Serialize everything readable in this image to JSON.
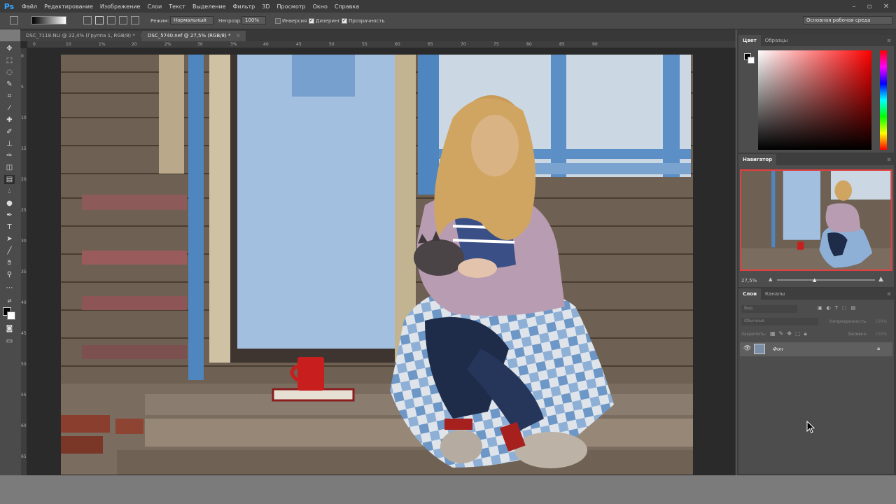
{
  "app": {
    "logo": "Ps",
    "menu": [
      "Файл",
      "Редактирование",
      "Изображение",
      "Слои",
      "Текст",
      "Выделение",
      "Фильтр",
      "3D",
      "Просмотр",
      "Окно",
      "Справка"
    ]
  },
  "options": {
    "mode_label": "Режим:",
    "mode_value": "Нормальный",
    "opacity_label": "Непрозр.:",
    "opacity_value": "100%",
    "inverse_label": "Инверсия",
    "dither_label": "Дизеринг",
    "transparency_label": "Прозрачность",
    "inverse_checked": false,
    "dither_checked": true,
    "transparency_checked": true,
    "workspace": "Основная рабочая среда"
  },
  "tabs": [
    {
      "label": "DSC_7118.NLI @ 22,4% (Группа 1, RGB/8) *",
      "active": false
    },
    {
      "label": "DSC_5740.nef @ 27,5% (RGB/8) *",
      "active": true
    }
  ],
  "ruler": {
    "h_labels": [
      "0",
      "10",
      "1%",
      "20",
      "2%",
      "30",
      "3%",
      "40",
      "45",
      "50",
      "55",
      "60",
      "65",
      "70",
      "75",
      "80",
      "85",
      "90"
    ],
    "v_labels": [
      "0",
      "5",
      "10",
      "15",
      "20",
      "25",
      "30",
      "35",
      "40",
      "45",
      "50",
      "55",
      "60",
      "65"
    ]
  },
  "color_panel": {
    "tabs": [
      "Цвет",
      "Образцы"
    ],
    "active_tab": "Цвет",
    "hue_color": "#ff0000"
  },
  "navigator": {
    "title": "Навигатор",
    "zoom": "27,5%"
  },
  "layers_panel": {
    "tabs": [
      "Слои",
      "Каналы"
    ],
    "active_tab": "Слои",
    "search_placeholder": "Вид",
    "blend_mode": "Обычные",
    "opacity_label": "Непрозрачность:",
    "opacity_value": "100%",
    "lock_label": "Закрепить:",
    "fill_label": "Заливка:",
    "fill_value": "100%",
    "layers": [
      {
        "name": "Фон",
        "visible": true,
        "locked": true
      }
    ]
  },
  "colors": {
    "ui_dark": "#3a3a3a",
    "ui_mid": "#4d4d4d",
    "accent_blue": "#35a5ff"
  }
}
